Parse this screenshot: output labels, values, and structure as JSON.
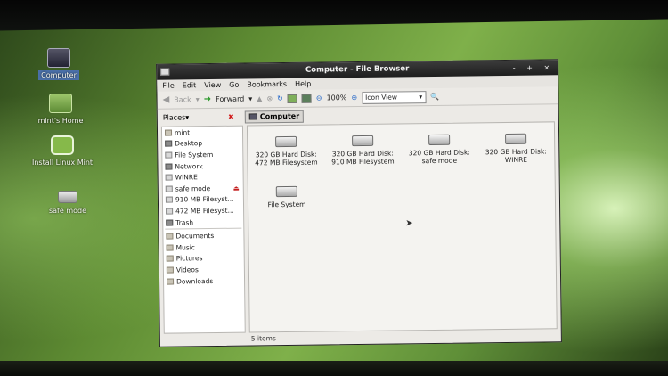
{
  "desktop": {
    "icons": [
      {
        "label": "Computer"
      },
      {
        "label": "mint's Home"
      },
      {
        "label": "Install Linux Mint"
      },
      {
        "label": "safe mode"
      }
    ]
  },
  "window": {
    "title": "Computer - File Browser",
    "controls": [
      "-",
      "+",
      "×"
    ]
  },
  "menubar": [
    "File",
    "Edit",
    "View",
    "Go",
    "Bookmarks",
    "Help"
  ],
  "toolbar": {
    "back": "Back",
    "forward": "Forward",
    "zoom": "100%",
    "view_mode": "Icon View"
  },
  "location": {
    "places_label": "Places",
    "current": "Computer"
  },
  "sidebar": {
    "devices": [
      "mint",
      "Desktop",
      "File System",
      "Network",
      "WINRE",
      "safe mode",
      "910 MB Filesyst...",
      "472 MB Filesyst...",
      "Trash"
    ],
    "bookmarks": [
      "Documents",
      "Music",
      "Pictures",
      "Videos",
      "Downloads"
    ]
  },
  "files": [
    {
      "line1": "320 GB Hard Disk:",
      "line2": "472 MB Filesystem"
    },
    {
      "line1": "320 GB Hard Disk:",
      "line2": "910 MB Filesystem"
    },
    {
      "line1": "320 GB Hard Disk:",
      "line2": "safe mode"
    },
    {
      "line1": "320 GB Hard Disk:",
      "line2": "WINRE"
    },
    {
      "line1": "File System",
      "line2": ""
    }
  ],
  "status": "5 items"
}
